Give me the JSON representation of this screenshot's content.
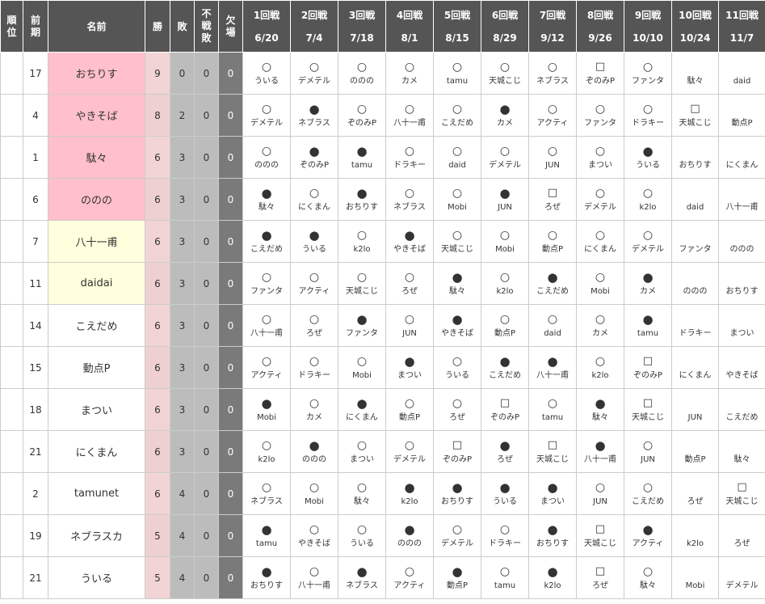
{
  "headers": {
    "rank": "順位",
    "prev": "前期",
    "name": "名前",
    "win": "勝",
    "loss": "敗",
    "nofight": "不戦敗",
    "absent": "欠場"
  },
  "rounds": [
    {
      "label": "1回戦",
      "date": "6/20"
    },
    {
      "label": "2回戦",
      "date": "7/4"
    },
    {
      "label": "3回戦",
      "date": "7/18"
    },
    {
      "label": "4回戦",
      "date": "8/1"
    },
    {
      "label": "5回戦",
      "date": "8/15"
    },
    {
      "label": "6回戦",
      "date": "8/29"
    },
    {
      "label": "7回戦",
      "date": "9/12"
    },
    {
      "label": "8回戦",
      "date": "9/26"
    },
    {
      "label": "9回戦",
      "date": "10/10"
    },
    {
      "label": "10回戦",
      "date": "10/24"
    },
    {
      "label": "11回戦",
      "date": "11/7"
    }
  ],
  "symbols": {
    "win": "○",
    "loss": "●",
    "nofight": "□",
    "none": ""
  },
  "colors": {
    "header_bg": "#555555",
    "pink": "#ffc0cb",
    "yellow": "#ffffdd",
    "win_col": "#f2d4d4",
    "loss_col": "#bcbcbc",
    "absent_col": "#7a7a7a"
  },
  "rows": [
    {
      "rank": "",
      "prev": "17",
      "name": "おちりす",
      "highlight": "pink",
      "w": "9",
      "l": "0",
      "nf": "0",
      "ab": "0",
      "results": [
        [
          "win",
          "ういる"
        ],
        [
          "win",
          "デメテル"
        ],
        [
          "win",
          "ののの"
        ],
        [
          "win",
          "カメ"
        ],
        [
          "win",
          "tamu"
        ],
        [
          "win",
          "天城こじ"
        ],
        [
          "win",
          "ネブラス"
        ],
        [
          "nofight",
          "ぞのみP"
        ],
        [
          "win",
          "ファンタ"
        ],
        [
          "none",
          "駄々"
        ],
        [
          "none",
          "daid"
        ]
      ]
    },
    {
      "rank": "",
      "prev": "4",
      "name": "やきそば",
      "highlight": "pink",
      "w": "8",
      "l": "2",
      "nf": "0",
      "ab": "0",
      "results": [
        [
          "win",
          "デメテル"
        ],
        [
          "loss",
          "ネブラス"
        ],
        [
          "win",
          "ぞのみP"
        ],
        [
          "win",
          "八十一甫"
        ],
        [
          "win",
          "こえだめ"
        ],
        [
          "loss",
          "カメ"
        ],
        [
          "win",
          "アクティ"
        ],
        [
          "win",
          "ファンタ"
        ],
        [
          "win",
          "ドラキー"
        ],
        [
          "nofight",
          "天城こじ"
        ],
        [
          "none",
          "動点P"
        ]
      ]
    },
    {
      "rank": "",
      "prev": "1",
      "name": "駄々",
      "highlight": "pink",
      "w": "6",
      "l": "3",
      "nf": "0",
      "ab": "0",
      "results": [
        [
          "win",
          "ののの"
        ],
        [
          "loss",
          "ぞのみP"
        ],
        [
          "loss",
          "tamu"
        ],
        [
          "win",
          "ドラキー"
        ],
        [
          "win",
          "daid"
        ],
        [
          "win",
          "デメテル"
        ],
        [
          "win",
          "JUN"
        ],
        [
          "win",
          "まつい"
        ],
        [
          "loss",
          "ういる"
        ],
        [
          "none",
          "おちりす"
        ],
        [
          "none",
          "にくまん"
        ]
      ]
    },
    {
      "rank": "",
      "prev": "6",
      "name": "ののの",
      "highlight": "pink",
      "w": "6",
      "l": "3",
      "nf": "0",
      "ab": "0",
      "results": [
        [
          "loss",
          "駄々"
        ],
        [
          "win",
          "にくまん"
        ],
        [
          "loss",
          "おちりす"
        ],
        [
          "win",
          "ネブラス"
        ],
        [
          "win",
          "Mobi"
        ],
        [
          "loss",
          "JUN"
        ],
        [
          "nofight",
          "ろぜ"
        ],
        [
          "win",
          "デメテル"
        ],
        [
          "win",
          "k2lo"
        ],
        [
          "none",
          "daid"
        ],
        [
          "none",
          "八十一甫"
        ]
      ]
    },
    {
      "rank": "",
      "prev": "7",
      "name": "八十一甫",
      "highlight": "yellow",
      "w": "6",
      "l": "3",
      "nf": "0",
      "ab": "0",
      "results": [
        [
          "loss",
          "こえだめ"
        ],
        [
          "loss",
          "ういる"
        ],
        [
          "win",
          "k2lo"
        ],
        [
          "loss",
          "やきそば"
        ],
        [
          "win",
          "天城こじ"
        ],
        [
          "win",
          "Mobi"
        ],
        [
          "win",
          "動点P"
        ],
        [
          "win",
          "にくまん"
        ],
        [
          "win",
          "デメテル"
        ],
        [
          "none",
          "ファンタ"
        ],
        [
          "none",
          "ののの"
        ]
      ]
    },
    {
      "rank": "",
      "prev": "11",
      "name": "daidai",
      "highlight": "yellow",
      "w": "6",
      "l": "3",
      "nf": "0",
      "ab": "0",
      "results": [
        [
          "win",
          "ファンタ"
        ],
        [
          "win",
          "アクティ"
        ],
        [
          "win",
          "天城こじ"
        ],
        [
          "win",
          "ろぜ"
        ],
        [
          "loss",
          "駄々"
        ],
        [
          "win",
          "k2lo"
        ],
        [
          "loss",
          "こえだめ"
        ],
        [
          "win",
          "Mobi"
        ],
        [
          "loss",
          "カメ"
        ],
        [
          "none",
          "ののの"
        ],
        [
          "none",
          "おちりす"
        ]
      ]
    },
    {
      "rank": "",
      "prev": "14",
      "name": "こえだめ",
      "highlight": "plain",
      "w": "6",
      "l": "3",
      "nf": "0",
      "ab": "0",
      "results": [
        [
          "win",
          "八十一甫"
        ],
        [
          "win",
          "ろぜ"
        ],
        [
          "loss",
          "ファンタ"
        ],
        [
          "win",
          "JUN"
        ],
        [
          "loss",
          "やきそば"
        ],
        [
          "win",
          "動点P"
        ],
        [
          "win",
          "daid"
        ],
        [
          "win",
          "カメ"
        ],
        [
          "loss",
          "tamu"
        ],
        [
          "none",
          "ドラキー"
        ],
        [
          "none",
          "まつい"
        ]
      ]
    },
    {
      "rank": "",
      "prev": "15",
      "name": "動点P",
      "highlight": "plain",
      "w": "6",
      "l": "3",
      "nf": "0",
      "ab": "0",
      "results": [
        [
          "win",
          "アクティ"
        ],
        [
          "win",
          "ドラキー"
        ],
        [
          "win",
          "Mobi"
        ],
        [
          "loss",
          "まつい"
        ],
        [
          "win",
          "ういる"
        ],
        [
          "loss",
          "こえだめ"
        ],
        [
          "loss",
          "八十一甫"
        ],
        [
          "win",
          "k2lo"
        ],
        [
          "nofight",
          "ぞのみP"
        ],
        [
          "none",
          "にくまん"
        ],
        [
          "none",
          "やきそば"
        ]
      ]
    },
    {
      "rank": "",
      "prev": "18",
      "name": "まつい",
      "highlight": "plain",
      "w": "6",
      "l": "3",
      "nf": "0",
      "ab": "0",
      "results": [
        [
          "loss",
          "Mobi"
        ],
        [
          "win",
          "カメ"
        ],
        [
          "loss",
          "にくまん"
        ],
        [
          "win",
          "動点P"
        ],
        [
          "win",
          "ろぜ"
        ],
        [
          "nofight",
          "ぞのみP"
        ],
        [
          "win",
          "tamu"
        ],
        [
          "loss",
          "駄々"
        ],
        [
          "nofight",
          "天城こじ"
        ],
        [
          "none",
          "JUN"
        ],
        [
          "none",
          "こえだめ"
        ]
      ]
    },
    {
      "rank": "",
      "prev": "21",
      "name": "にくまん",
      "highlight": "plain",
      "w": "6",
      "l": "3",
      "nf": "0",
      "ab": "0",
      "results": [
        [
          "win",
          "k2lo"
        ],
        [
          "loss",
          "ののの"
        ],
        [
          "win",
          "まつい"
        ],
        [
          "win",
          "デメテル"
        ],
        [
          "nofight",
          "ぞのみP"
        ],
        [
          "loss",
          "ろぜ"
        ],
        [
          "nofight",
          "天城こじ"
        ],
        [
          "loss",
          "八十一甫"
        ],
        [
          "win",
          "JUN"
        ],
        [
          "none",
          "動点P"
        ],
        [
          "none",
          "駄々"
        ]
      ]
    },
    {
      "rank": "",
      "prev": "2",
      "name": "tamunet",
      "highlight": "plain",
      "w": "6",
      "l": "4",
      "nf": "0",
      "ab": "0",
      "results": [
        [
          "win",
          "ネブラス"
        ],
        [
          "win",
          "Mobi"
        ],
        [
          "win",
          "駄々"
        ],
        [
          "loss",
          "k2lo"
        ],
        [
          "loss",
          "おちりす"
        ],
        [
          "loss",
          "ういる"
        ],
        [
          "loss",
          "まつい"
        ],
        [
          "win",
          "JUN"
        ],
        [
          "win",
          "こえだめ"
        ],
        [
          "none",
          "ろぜ"
        ],
        [
          "nofight",
          "天城こじ"
        ]
      ]
    },
    {
      "rank": "",
      "prev": "19",
      "name": "ネブラスカ",
      "highlight": "plain",
      "w": "5",
      "l": "4",
      "nf": "0",
      "ab": "0",
      "results": [
        [
          "loss",
          "tamu"
        ],
        [
          "win",
          "やきそば"
        ],
        [
          "win",
          "ういる"
        ],
        [
          "loss",
          "ののの"
        ],
        [
          "win",
          "デメテル"
        ],
        [
          "win",
          "ドラキー"
        ],
        [
          "loss",
          "おちりす"
        ],
        [
          "nofight",
          "天城こじ"
        ],
        [
          "loss",
          "アクティ"
        ],
        [
          "none",
          "k2lo"
        ],
        [
          "none",
          "ろぜ"
        ]
      ]
    },
    {
      "rank": "",
      "prev": "21",
      "name": "ういる",
      "highlight": "plain",
      "w": "5",
      "l": "4",
      "nf": "0",
      "ab": "0",
      "results": [
        [
          "loss",
          "おちりす"
        ],
        [
          "win",
          "八十一甫"
        ],
        [
          "loss",
          "ネブラス"
        ],
        [
          "win",
          "アクティ"
        ],
        [
          "loss",
          "動点P"
        ],
        [
          "win",
          "tamu"
        ],
        [
          "loss",
          "k2lo"
        ],
        [
          "nofight",
          "ろぜ"
        ],
        [
          "win",
          "駄々"
        ],
        [
          "none",
          "Mobi"
        ],
        [
          "none",
          "デメテル"
        ]
      ]
    }
  ]
}
